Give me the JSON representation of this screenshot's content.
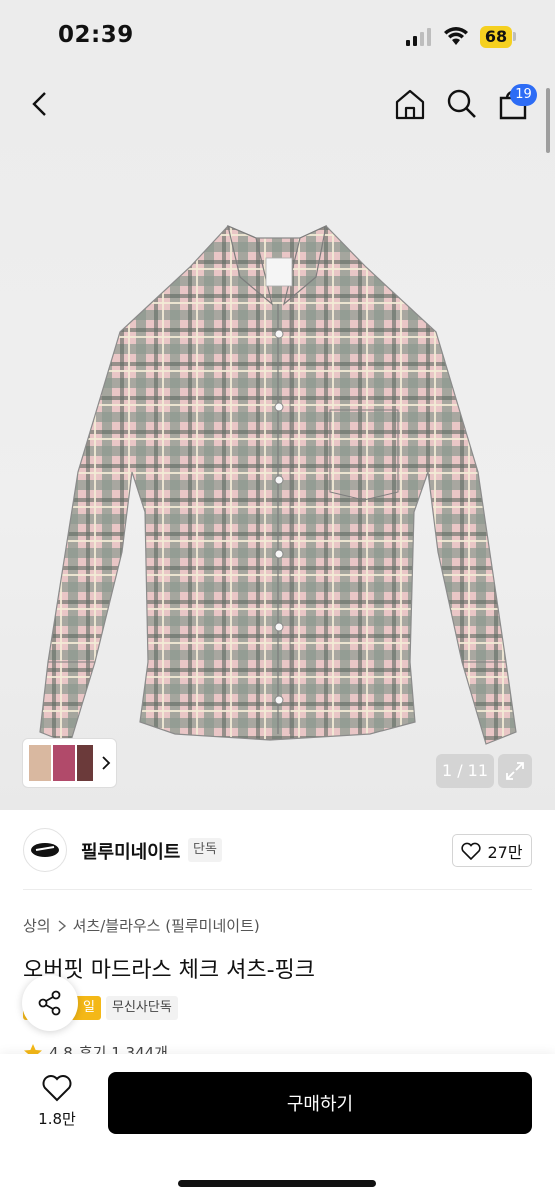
{
  "status_bar": {
    "time": "02:39",
    "battery": "68"
  },
  "header": {
    "cart_count": "19"
  },
  "gallery": {
    "counter": "1 / 11"
  },
  "brand": {
    "name": "필루미네이트",
    "tag": "단독",
    "likes": "27만"
  },
  "breadcrumb": {
    "items": [
      "상의",
      "셔츠/블라우스 (필루미네이트)"
    ]
  },
  "product": {
    "title": "오버핏 마드라스 체크 셔츠-핑크",
    "tag_orange": "일",
    "tag_gray": "무신사단독",
    "rating": "4.8",
    "reviews": "후기 1,344개"
  },
  "bottom": {
    "wish_count": "1.8만",
    "buy_label": "구매하기"
  },
  "colors": {
    "accent_badge": "#2d6cf5",
    "tag_orange": "#f4b817",
    "buy_button": "#000000"
  },
  "icons": [
    "back-icon",
    "home-icon",
    "search-icon",
    "cart-icon",
    "chevron-right-icon",
    "expand-icon",
    "heart-icon",
    "share-icon",
    "star-icon"
  ]
}
